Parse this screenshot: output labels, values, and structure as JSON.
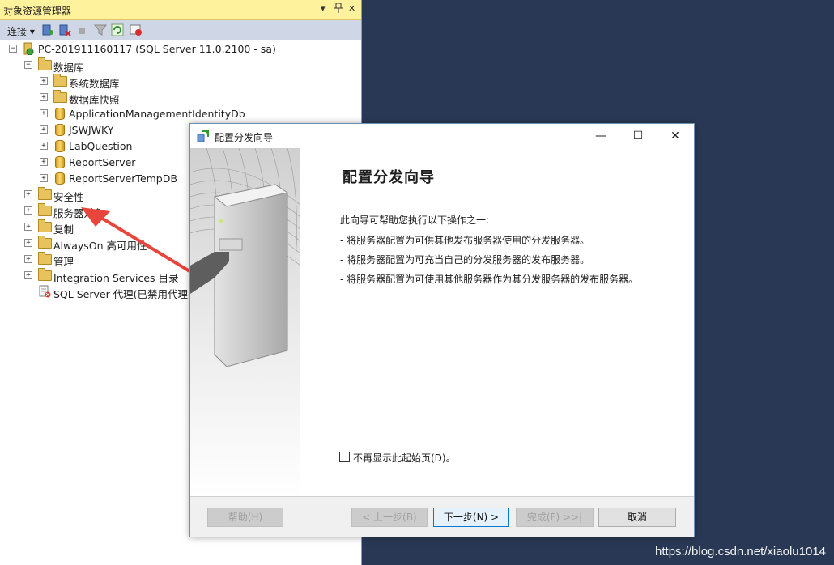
{
  "object_explorer": {
    "title": "对象资源管理器",
    "pin_glyph": "▾  ꟼ  ✕",
    "toolbar": {
      "connect_label": "连接 ▾"
    },
    "server_node": "PC-201911160117 (SQL Server 11.0.2100 - sa)",
    "tree": [
      {
        "label": "数据库",
        "expander": "⊟",
        "icon": "folder-icon",
        "level": 1
      },
      {
        "label": "系统数据库",
        "expander": "⊞",
        "icon": "folder-icon",
        "level": 2
      },
      {
        "label": "数据库快照",
        "expander": "⊞",
        "icon": "folder-icon",
        "level": 2
      },
      {
        "label": "ApplicationManagementIdentityDb",
        "expander": "⊞",
        "icon": "database-icon",
        "level": 2
      },
      {
        "label": "JSWJWKY",
        "expander": "⊞",
        "icon": "database-icon",
        "level": 2
      },
      {
        "label": "LabQuestion",
        "expander": "⊞",
        "icon": "database-icon",
        "level": 2
      },
      {
        "label": "ReportServer",
        "expander": "⊞",
        "icon": "database-icon",
        "level": 2
      },
      {
        "label": "ReportServerTempDB",
        "expander": "⊞",
        "icon": "database-icon",
        "level": 2
      },
      {
        "label": "安全性",
        "expander": "⊞",
        "icon": "folder-icon",
        "level": 1
      },
      {
        "label": "服务器对象",
        "expander": "⊞",
        "icon": "folder-icon",
        "level": 1
      },
      {
        "label": "复制",
        "expander": "⊞",
        "icon": "folder-icon",
        "level": 1
      },
      {
        "label": "AlwaysOn 高可用性",
        "expander": "⊞",
        "icon": "folder-icon",
        "level": 1
      },
      {
        "label": "管理",
        "expander": "⊞",
        "icon": "folder-icon",
        "level": 1
      },
      {
        "label": "Integration Services 目录",
        "expander": "⊞",
        "icon": "folder-icon",
        "level": 1
      },
      {
        "label": "SQL Server 代理(已禁用代理 XP)",
        "expander": "",
        "icon": "agent-icon",
        "level": 1
      }
    ]
  },
  "dialog": {
    "title": "配置分发向导",
    "window_controls": {
      "minimize": "—",
      "maximize": "☐",
      "close": "✕"
    },
    "heading": "配置分发向导",
    "intro": "此向导可帮助您执行以下操作之一:",
    "bullets": [
      "- 将服务器配置为可供其他发布服务器使用的分发服务器。",
      "- 将服务器配置为可充当自己的分发服务器的发布服务器。",
      "- 将服务器配置为可使用其他服务器作为其分发服务器的发布服务器。"
    ],
    "checkbox_label": "不再显示此起始页(D)。",
    "checkbox_checked": false,
    "buttons": {
      "help": "帮助(H)",
      "back": "< 上一步(B)",
      "next": "下一步(N) >",
      "finish": "完成(F) >>|",
      "cancel": "取消"
    }
  },
  "watermark": "https://blog.csdn.net/xiaolu1014",
  "colors": {
    "desktop": "#293955",
    "title_yellow": "#fff29d",
    "annotation_arrow": "#e8453c"
  }
}
